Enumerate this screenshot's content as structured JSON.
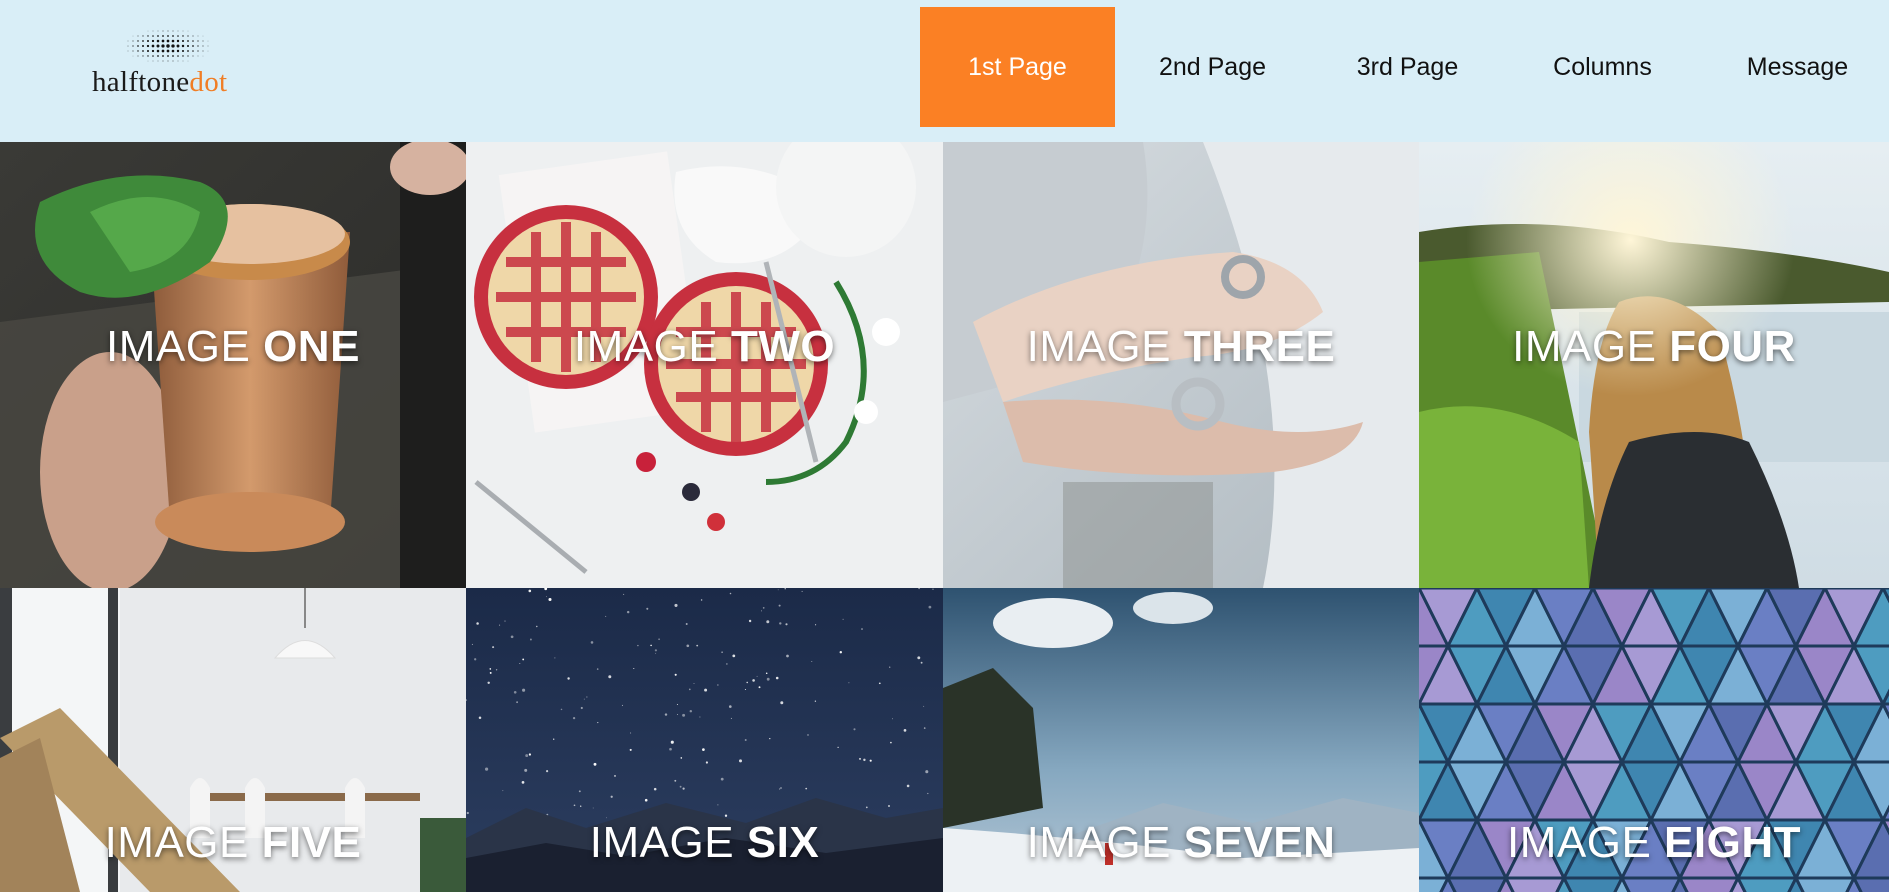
{
  "logo": {
    "text_main": "halftone",
    "text_accent": "dot"
  },
  "nav": {
    "items": [
      {
        "label": "1st Page",
        "active": true
      },
      {
        "label": "2nd Page",
        "active": false
      },
      {
        "label": "3rd Page",
        "active": false
      },
      {
        "label": "Columns",
        "active": false
      },
      {
        "label": "Message",
        "active": false
      }
    ]
  },
  "gallery": {
    "tiles": [
      {
        "prefix": "IMAGE",
        "word": "ONE"
      },
      {
        "prefix": "IMAGE",
        "word": "TWO"
      },
      {
        "prefix": "IMAGE",
        "word": "THREE"
      },
      {
        "prefix": "IMAGE",
        "word": "FOUR"
      },
      {
        "prefix": "IMAGE",
        "word": "FIVE"
      },
      {
        "prefix": "IMAGE",
        "word": "SIX"
      },
      {
        "prefix": "IMAGE",
        "word": "SEVEN"
      },
      {
        "prefix": "IMAGE",
        "word": "EIGHT"
      }
    ]
  },
  "colors": {
    "background": "#d9eef7",
    "accent": "#fb8024"
  }
}
